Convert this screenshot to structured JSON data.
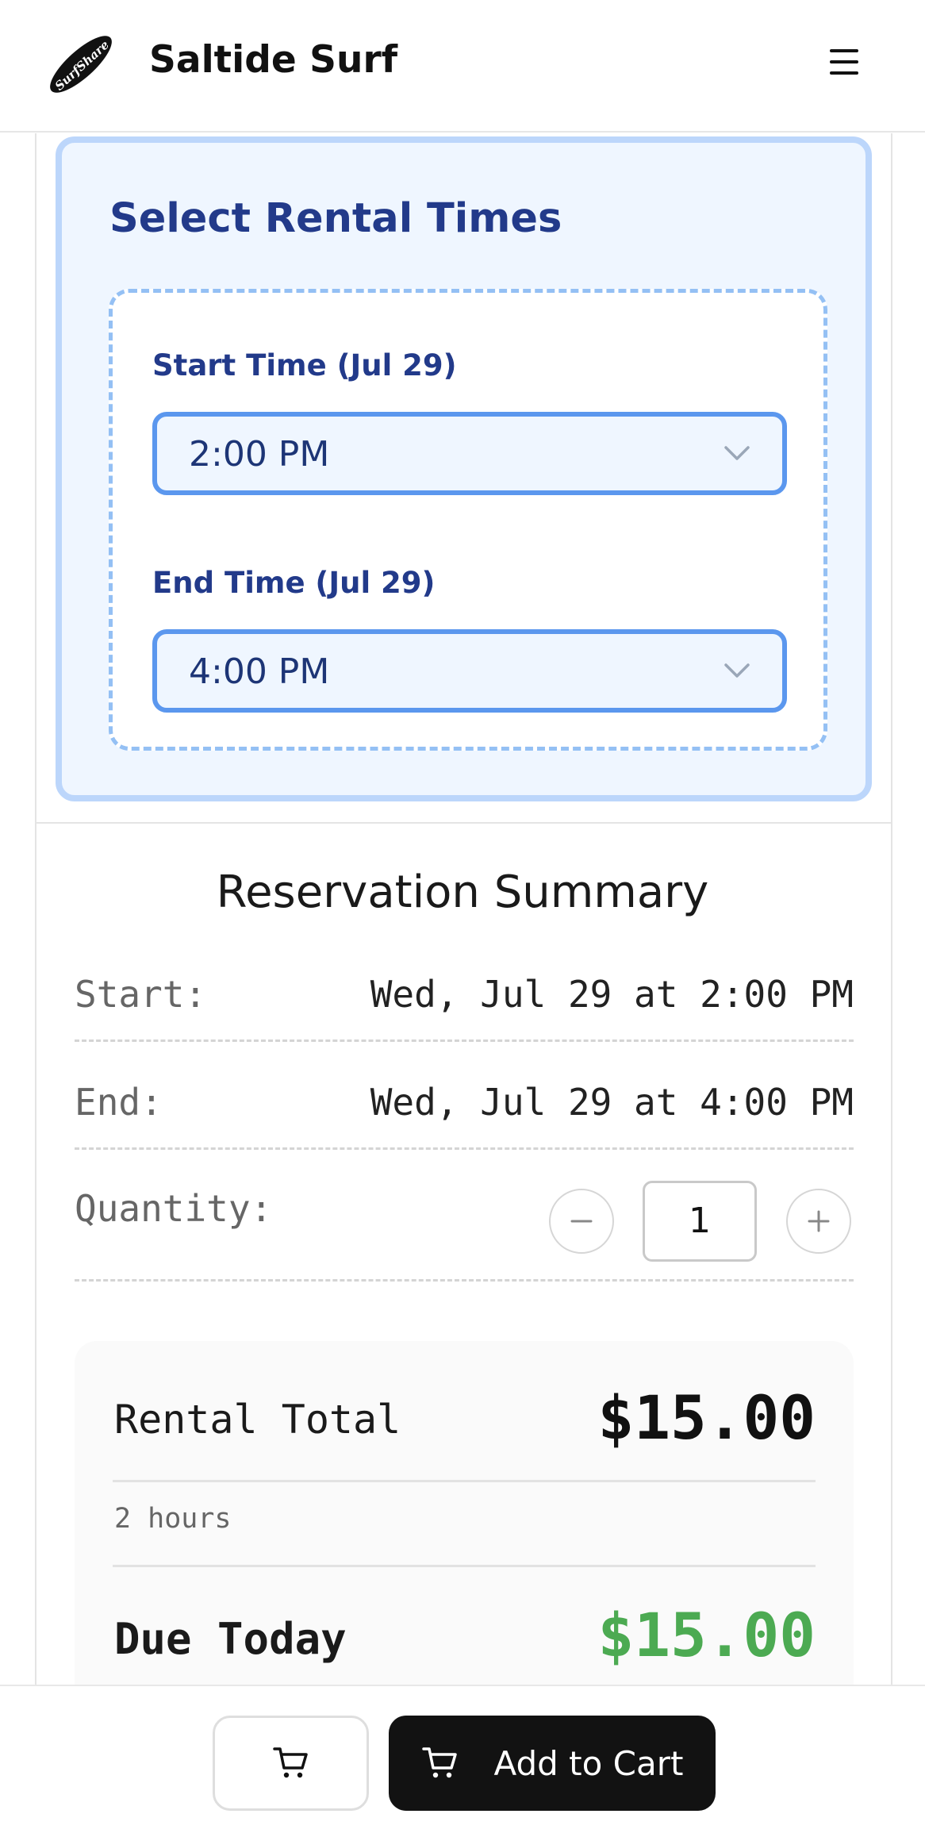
{
  "header": {
    "brand": "Saltide Surf",
    "logo_text": "SurfShare",
    "menu_icon": "hamburger-menu-icon"
  },
  "rental_times": {
    "title": "Select Rental Times",
    "start_label": "Start Time (Jul 29)",
    "start_value": "2:00 PM",
    "end_label": "End Time (Jul 29)",
    "end_value": "4:00 PM"
  },
  "summary": {
    "title": "Reservation Summary",
    "start_label": "Start:",
    "start_value": "Wed, Jul 29 at 2:00 PM",
    "end_label": "End:",
    "end_value": "Wed, Jul 29 at 4:00 PM",
    "quantity_label": "Quantity:",
    "quantity_value": "1"
  },
  "totals": {
    "rental_total_label": "Rental Total",
    "rental_total_value": "$15.00",
    "duration": "2 hours",
    "due_today_label": "Due Today",
    "due_today_value": "$15.00"
  },
  "bottom_bar": {
    "add_to_cart_label": "Add to Cart"
  },
  "colors": {
    "accent_blue": "#223a8a",
    "select_border": "#5b97ee",
    "card_bg": "#eff6ff",
    "due_green": "#4caa52",
    "button_dark": "#121212"
  }
}
